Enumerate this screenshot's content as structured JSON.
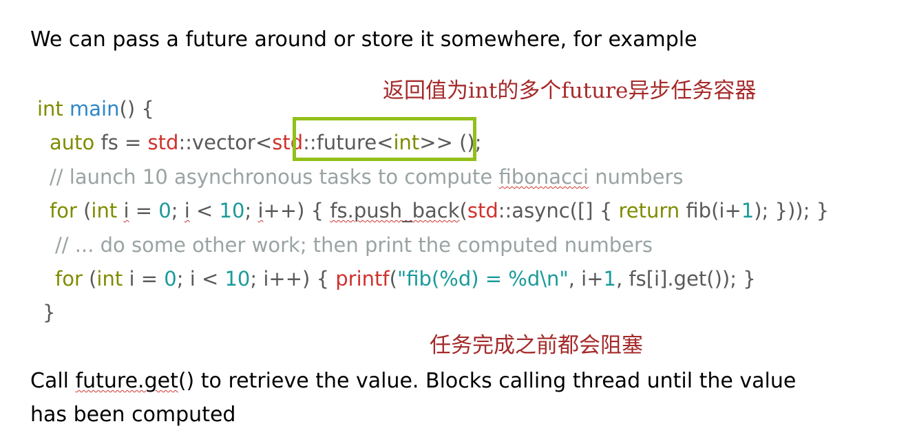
{
  "intro": "We can pass a future around or store it somewhere, for example",
  "annotation_top": "返回值为int的多个future异步任务容器",
  "annotation_bottom": "任务完成之前都会阻塞",
  "code": {
    "l1": {
      "kw": "int",
      "fn": "main",
      "rest": "() {"
    },
    "l2": {
      "kw": "auto",
      "a": " fs = ",
      "std1": "std",
      "b": "::vector<",
      "std2": "std",
      "c": "::future<",
      "int": "int",
      "d": ">> ();"
    },
    "l3": {
      "a": "// launch 10 asynchronous tasks to compute ",
      "u": "fibonacci",
      "b": " numbers"
    },
    "l4": {
      "kw_for": "for",
      "a": " (",
      "kw_int": "int",
      "sp": " ",
      "i1": "i",
      "b": " = ",
      "n0": "0",
      "c": "; ",
      "i2": "i",
      "d": " < ",
      "n10": "10",
      "e": "; ",
      "i3": "i",
      "f": "++) { ",
      "push": "fs.push_back",
      "g": "(",
      "std": "std",
      "h": "::async([] { ",
      "kw_ret": "return",
      "j": " fib(i+",
      "n1": "1",
      "k": "); })); }"
    },
    "l5": "// ... do some other work; then print the computed numbers",
    "l6": {
      "kw_for": "for",
      "a": " (",
      "kw_int": "int",
      "b": " i = ",
      "n0": "0",
      "c": "; i < ",
      "n10": "10",
      "d": "; i++) { ",
      "printf": "printf",
      "e": "(",
      "str": "\"fib(%d) = %d\\n\"",
      "f": ", i+",
      "n1": "1",
      "g": ", fs[i].get()); }"
    },
    "l7": "}"
  },
  "outro": {
    "a": "Call ",
    "u": "future.get",
    "b": "() to retrieve the value. Blocks calling thread until the value",
    "line2": "has been computed"
  },
  "colors": {
    "keyword": "#7f8c00",
    "function": "#2e86c8",
    "std": "#d0312d",
    "number": "#1a9a9a",
    "comment": "#9aa3a3",
    "annotation": "#a52a2a",
    "highlight_box": "#92c01a"
  }
}
